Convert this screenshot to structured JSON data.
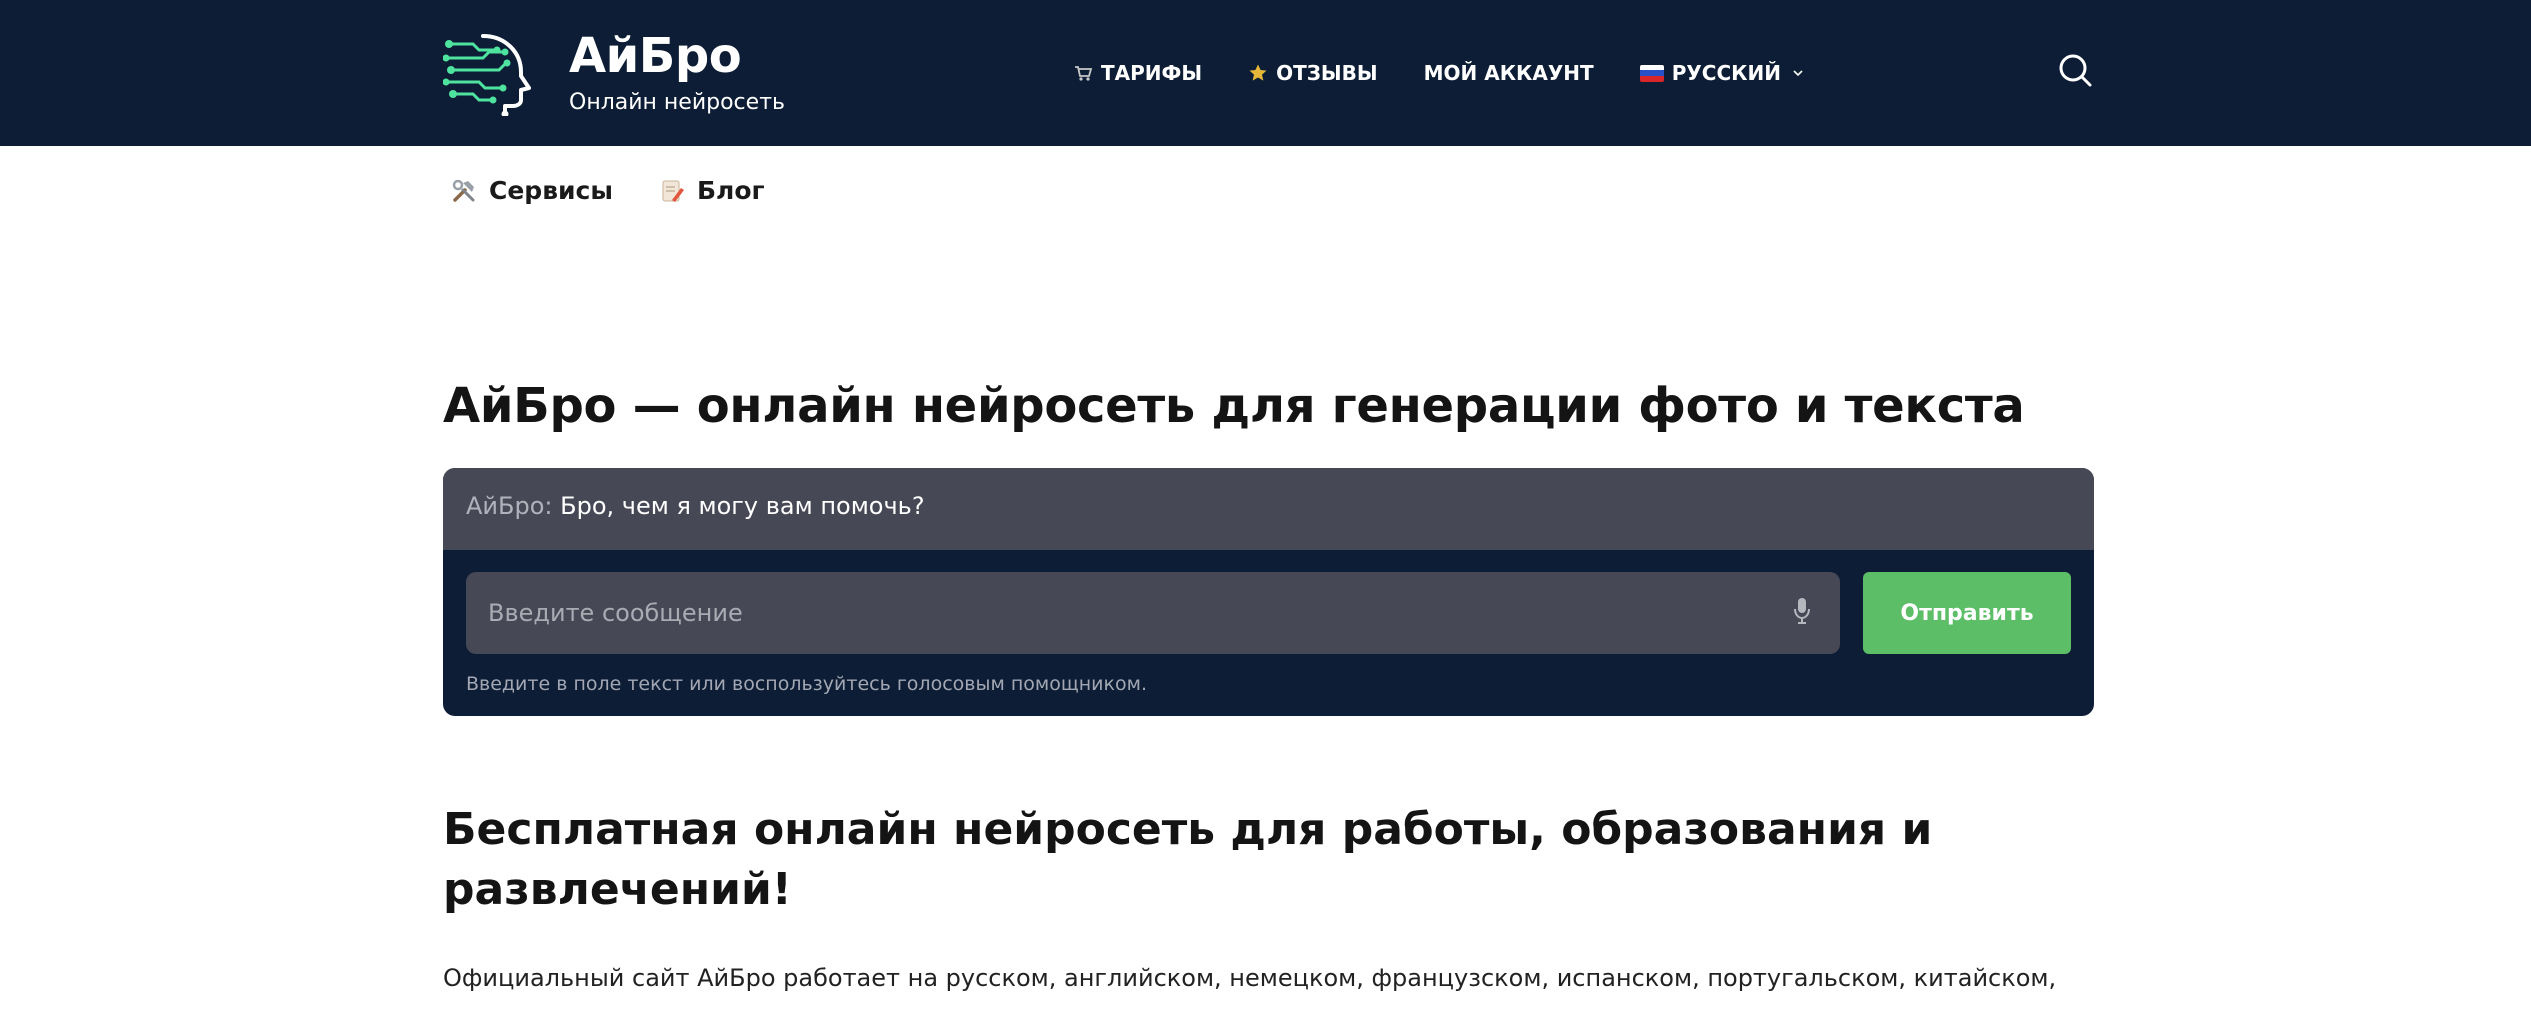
{
  "header": {
    "brand": "АйБро",
    "tagline": "Онлайн нейросеть",
    "nav": [
      {
        "label": "Тарифы",
        "icon": "shopping-cart-icon"
      },
      {
        "label": "Отзывы",
        "icon": "star-icon"
      },
      {
        "label": "Мой аккаунт"
      },
      {
        "label": "Русский",
        "icon": "russian-flag-icon"
      }
    ],
    "search_icon": "search-icon"
  },
  "subnav": [
    {
      "label": "Сервисы",
      "icon": "tools-icon"
    },
    {
      "label": "Блог",
      "icon": "memo-icon"
    }
  ],
  "main": {
    "title": "АйБро — онлайн нейросеть для генерации фото и текста",
    "chat": {
      "speaker": "АйБро:",
      "message": "Бро, чем я могу вам помочь?",
      "input_placeholder": "Введите сообщение",
      "input_value": "",
      "send_label": "Отправить",
      "hint": "Введите в поле текст или воспользуйтесь голосовым помощником."
    },
    "section_title": "Бесплатная онлайн нейросеть для работы, образования и развлечений!",
    "paragraph": "Официальный сайт АйБро работает на русском, английском, немецком, французском, испанском, португальском, китайском,"
  },
  "colors": {
    "header_bg": "#0c1d35",
    "chat_panel": "#474856",
    "accent_green": "#5cbe67",
    "logo_green": "#4fe3a0"
  }
}
